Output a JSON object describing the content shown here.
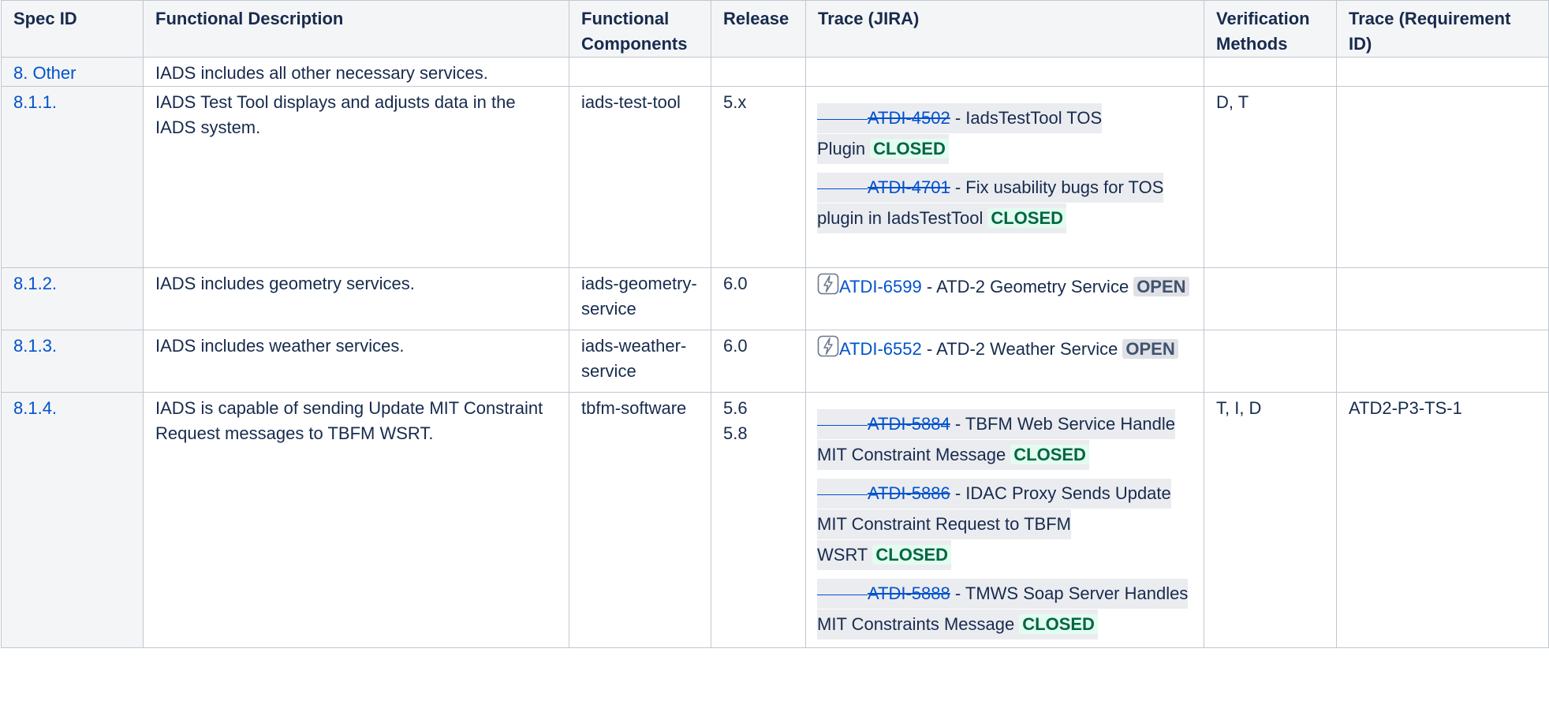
{
  "headers": [
    "Spec ID",
    "Functional Description",
    "Functional Components",
    "Release",
    "Trace (JIRA)",
    "Verification Methods",
    "Trace (Requirement ID)"
  ],
  "rows": [
    {
      "spec_id": "8. Other",
      "description": "IADS includes all other necessary services.",
      "components": "",
      "release": "",
      "verification": "",
      "req_id": "",
      "issues": []
    },
    {
      "spec_id": "8.1.1.",
      "description": "IADS Test Tool displays and adjusts data in the IADS system.",
      "components": "iads-test-tool",
      "release": "5.x",
      "verification": "D, T",
      "req_id": "",
      "issues": [
        {
          "key": "ATDI-4502",
          "summary": " - IadsTestTool TOS Plugin",
          "status": "CLOSED",
          "icon": ""
        },
        {
          "key": "ATDI-4701",
          "summary": " - Fix usability bugs for TOS plugin in IadsTestTool",
          "status": "CLOSED",
          "icon": ""
        }
      ]
    },
    {
      "spec_id": "8.1.2.",
      "description": "IADS includes geometry services.",
      "components": "iads-geometry-service",
      "release": "6.0",
      "verification": "",
      "req_id": "",
      "issues": [
        {
          "key": "ATDI-6599",
          "summary": " - ATD-2 Geometry Service",
          "status": "OPEN",
          "icon": "epic-bolt-icon"
        }
      ]
    },
    {
      "spec_id": "8.1.3.",
      "description": "IADS includes weather services.",
      "components": "iads-weather-service",
      "release": "6.0",
      "verification": "",
      "req_id": "",
      "issues": [
        {
          "key": "ATDI-6552",
          "summary": " - ATD-2 Weather Service",
          "status": "OPEN",
          "icon": "epic-bolt-icon"
        }
      ]
    },
    {
      "spec_id": "8.1.4.",
      "description": "IADS is capable of sending Update MIT Constraint Request messages to TBFM WSRT.",
      "components": "tbfm-software",
      "release": "5.6\n5.8",
      "verification": "T, I, D",
      "req_id": "ATD2-P3-TS-1",
      "issues": [
        {
          "key": "ATDI-5884",
          "summary": " - TBFM Web Service Handle MIT Constraint Message",
          "status": "CLOSED",
          "icon": ""
        },
        {
          "key": "ATDI-5886",
          "summary": " - IDAC Proxy Sends Update MIT Constraint Request to TBFM WSRT",
          "status": "CLOSED",
          "icon": ""
        },
        {
          "key": "ATDI-5888",
          "summary": " - TMWS Soap Server Handles MIT Constraints Message",
          "status": "CLOSED",
          "icon": ""
        }
      ]
    }
  ]
}
